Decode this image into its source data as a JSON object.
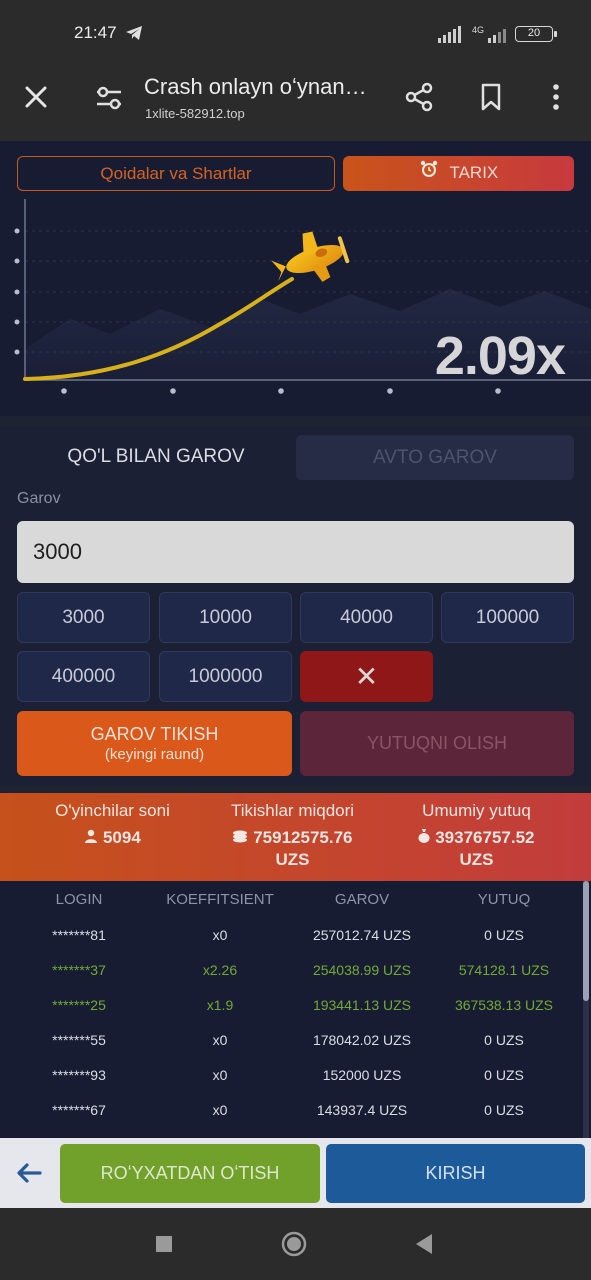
{
  "status_bar": {
    "time": "21:47",
    "network": "4G",
    "battery": "20"
  },
  "browser": {
    "title": "Crash onlayn oʻynan…",
    "url": "1xlite-582912.top"
  },
  "game": {
    "rules_label": "Qoidalar va Shartlar",
    "history_label": "TARIX",
    "multiplier": "2.09x"
  },
  "bet": {
    "tab_manual": "QO'L BILAN GAROV",
    "tab_auto": "AVTO GAROV",
    "stake_label": "Garov",
    "stake_value": "3000",
    "chips": [
      "3000",
      "10000",
      "40000",
      "100000",
      "400000",
      "1000000"
    ],
    "clear_label": "✕",
    "place_bet_line1": "GAROV TIKISH",
    "place_bet_line2": "(keyingi raund)",
    "cashout_label": "YUTUQNI OLISH"
  },
  "stats": {
    "players_label": "O'yinchilar soni",
    "players_value": "5094",
    "bets_label": "Tikishlar miqdori",
    "bets_value": "75912575.76",
    "bets_currency": "UZS",
    "wins_label": "Umumiy yutuq",
    "wins_value": "39376757.52",
    "wins_currency": "UZS"
  },
  "table": {
    "headers": [
      "LOGIN",
      "KOEFFITSIENT",
      "GAROV",
      "YUTUQ"
    ],
    "rows": [
      {
        "login": "*******81",
        "coef": "x0",
        "bet": "257012.74 UZS",
        "win": "0 UZS",
        "won": false
      },
      {
        "login": "*******37",
        "coef": "x2.26",
        "bet": "254038.99 UZS",
        "win": "574128.1 UZS",
        "won": true
      },
      {
        "login": "*******25",
        "coef": "x1.9",
        "bet": "193441.13 UZS",
        "win": "367538.13 UZS",
        "won": true
      },
      {
        "login": "*******55",
        "coef": "x0",
        "bet": "178042.02 UZS",
        "win": "0 UZS",
        "won": false
      },
      {
        "login": "*******93",
        "coef": "x0",
        "bet": "152000 UZS",
        "win": "0 UZS",
        "won": false
      },
      {
        "login": "*******67",
        "coef": "x0",
        "bet": "143937.4 UZS",
        "win": "0 UZS",
        "won": false
      }
    ]
  },
  "bottom": {
    "register_label": "ROʻYXATDAN OʻTISH",
    "login_label": "KIRISH"
  },
  "colors": {
    "accent_orange": "#d9581a",
    "win_green": "#73a934",
    "login_blue": "#1d5a99",
    "register_green": "#71a02b"
  }
}
